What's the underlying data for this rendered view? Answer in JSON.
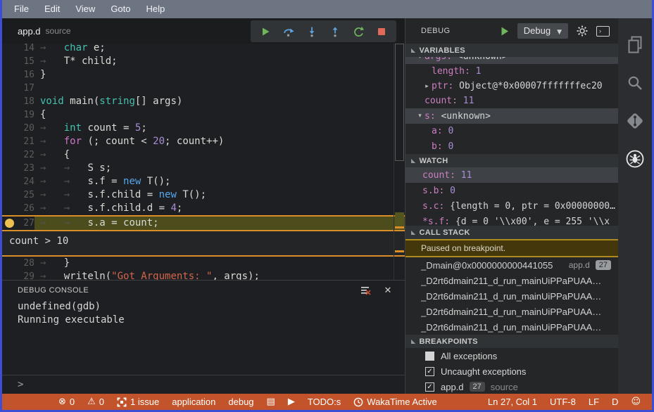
{
  "colors": {
    "window_border": "#3c4ed6",
    "status_bar": "#c2532b",
    "breakpoint": "#eec04f",
    "current_line_bg": "#4c4c1c",
    "current_line_border": "#d98e27",
    "keyword_teal": "#45c1ad",
    "keyword_pink": "#cb76c4",
    "keyword_blue": "#56a7ef",
    "number_purple": "#a98ed6",
    "string_orange": "#d2654c",
    "variable_name_pink": "#cd7ec0",
    "selection_gray": "#3e4247",
    "paused_banner_bg": "#44370b",
    "paused_banner_border": "#ad8b1e"
  },
  "menu_bar": {
    "items": [
      "File",
      "Edit",
      "View",
      "Goto",
      "Help"
    ]
  },
  "editor": {
    "tab": {
      "title": "app.d",
      "subtitle": "source"
    },
    "toolbar_icons": [
      "continue-icon",
      "step-over-icon",
      "step-into-icon",
      "step-out-icon",
      "restart-icon",
      "stop-icon"
    ],
    "breakpoint_line": 27,
    "condition": "count > 10",
    "lines_above": [
      {
        "num": "14",
        "segs": [
          [
            "ws",
            "→   "
          ],
          [
            "kw",
            "char"
          ],
          [
            "pl",
            " e;"
          ]
        ]
      },
      {
        "num": "15",
        "segs": [
          [
            "ws",
            "→   "
          ],
          [
            "pl",
            "T* child;"
          ]
        ]
      },
      {
        "num": "16",
        "segs": [
          [
            "pl",
            "}"
          ]
        ]
      },
      {
        "num": "17",
        "segs": []
      },
      {
        "num": "18",
        "segs": [
          [
            "kw",
            "void"
          ],
          [
            "pl",
            " main("
          ],
          [
            "kw",
            "string"
          ],
          [
            "pl",
            "[] args)"
          ]
        ]
      },
      {
        "num": "19",
        "segs": [
          [
            "pl",
            "{"
          ]
        ]
      },
      {
        "num": "20",
        "segs": [
          [
            "ws",
            "→   "
          ],
          [
            "kw",
            "int"
          ],
          [
            "pl",
            " count = "
          ],
          [
            "num",
            "5"
          ],
          [
            "pl",
            ";"
          ]
        ]
      },
      {
        "num": "21",
        "segs": [
          [
            "ws",
            "→   "
          ],
          [
            "ctl",
            "for"
          ],
          [
            "pl",
            " (; count < "
          ],
          [
            "num",
            "20"
          ],
          [
            "pl",
            "; count++)"
          ]
        ]
      },
      {
        "num": "22",
        "segs": [
          [
            "ws",
            "→   "
          ],
          [
            "pl",
            "{"
          ]
        ]
      },
      {
        "num": "23",
        "segs": [
          [
            "ws",
            "→   →   "
          ],
          [
            "pl",
            "S s;"
          ]
        ]
      },
      {
        "num": "24",
        "segs": [
          [
            "ws",
            "→   →   "
          ],
          [
            "pl",
            "s.f = "
          ],
          [
            "new",
            "new"
          ],
          [
            "pl",
            " T();"
          ]
        ]
      },
      {
        "num": "25",
        "segs": [
          [
            "ws",
            "→   →   "
          ],
          [
            "pl",
            "s.f.child = "
          ],
          [
            "new",
            "new"
          ],
          [
            "pl",
            " T();"
          ]
        ]
      },
      {
        "num": "26",
        "segs": [
          [
            "ws",
            "→   →   "
          ],
          [
            "pl",
            "s.f.child.d = "
          ],
          [
            "num",
            "4"
          ],
          [
            "pl",
            ";"
          ]
        ]
      },
      {
        "num": "27",
        "bp": true,
        "cur": true,
        "segs": [
          [
            "ws",
            "→   →   "
          ],
          [
            "pl",
            "s.a = count;"
          ]
        ]
      }
    ],
    "lines_below": [
      {
        "num": "28",
        "segs": [
          [
            "ws",
            "→   "
          ],
          [
            "pl",
            "}"
          ]
        ]
      },
      {
        "num": "29",
        "segs": [
          [
            "ws",
            "→   "
          ],
          [
            "pl",
            "writeln("
          ],
          [
            "str",
            "\"Got Arguments: \""
          ],
          [
            "pl",
            ", args);"
          ]
        ]
      }
    ]
  },
  "debug_console": {
    "title": "DEBUG CONSOLE",
    "lines": [
      "undefined(gdb)",
      "Running executable"
    ],
    "prompt": ">",
    "icons": [
      "clear-console-icon",
      "close-icon"
    ]
  },
  "debug_panel": {
    "title": "DEBUG",
    "launch_config": "Debug",
    "header_icons": [
      "start-debug-icon",
      "config-dropdown",
      "gear-icon",
      "open-console-icon"
    ],
    "sections": {
      "variables": "VARIABLES",
      "watch": "WATCH",
      "call_stack": "CALL STACK",
      "breakpoints": "BREAKPOINTS"
    },
    "variables": [
      {
        "name": "args:",
        "value": "<unknown>"
      },
      {
        "name": "length:",
        "value": "1"
      },
      {
        "name": "ptr:",
        "value": "Object@*0x00007fffffffec20"
      },
      {
        "name": "count:",
        "value": "11"
      },
      {
        "name": "s:",
        "value": "<unknown>"
      },
      {
        "name": "a:",
        "value": "0"
      },
      {
        "name": "b:",
        "value": "0"
      }
    ],
    "watch": [
      {
        "name": "count:",
        "value": "11"
      },
      {
        "name": "s.b:",
        "value": "0"
      },
      {
        "name": "s.c:",
        "value": "{length = 0, ptr = 0x00000000…"
      },
      {
        "name": "*s.f:",
        "value": "{d = 0 '\\\\x00', e = 255 '\\\\x"
      }
    ],
    "call_stack": {
      "status": "Paused on breakpoint.",
      "frames": [
        {
          "name": "_Dmain@0x0000000000441055",
          "file": "app.d",
          "line": "27"
        },
        {
          "name": "_D2rt6dmain211_d_run_mainUiPPaPUAA…"
        },
        {
          "name": "_D2rt6dmain211_d_run_mainUiPPaPUAA…"
        },
        {
          "name": "_D2rt6dmain211_d_run_mainUiPPaPUAA…"
        },
        {
          "name": "_D2rt6dmain211_d_run_mainUiPPaPUAA…"
        }
      ]
    },
    "breakpoints": [
      {
        "label": "All exceptions",
        "checked": false
      },
      {
        "label": "Uncaught exceptions",
        "checked": true
      },
      {
        "label": "app.d",
        "line": "27",
        "suffix": "source",
        "checked": true
      }
    ]
  },
  "activity_bar": {
    "icons": [
      "files-icon",
      "search-icon",
      "source-control-icon",
      "debug-icon"
    ],
    "active": "debug"
  },
  "status_bar": {
    "left": {
      "errors": "0",
      "warnings": "0",
      "issues": "1 issue",
      "task": "application",
      "mode": "debug",
      "todo": "TODO:s",
      "wakatime": "WakaTime Active"
    },
    "right": {
      "cursor": "Ln 27, Col 1",
      "encoding": "UTF-8",
      "eol": "LF",
      "language": "D"
    }
  }
}
